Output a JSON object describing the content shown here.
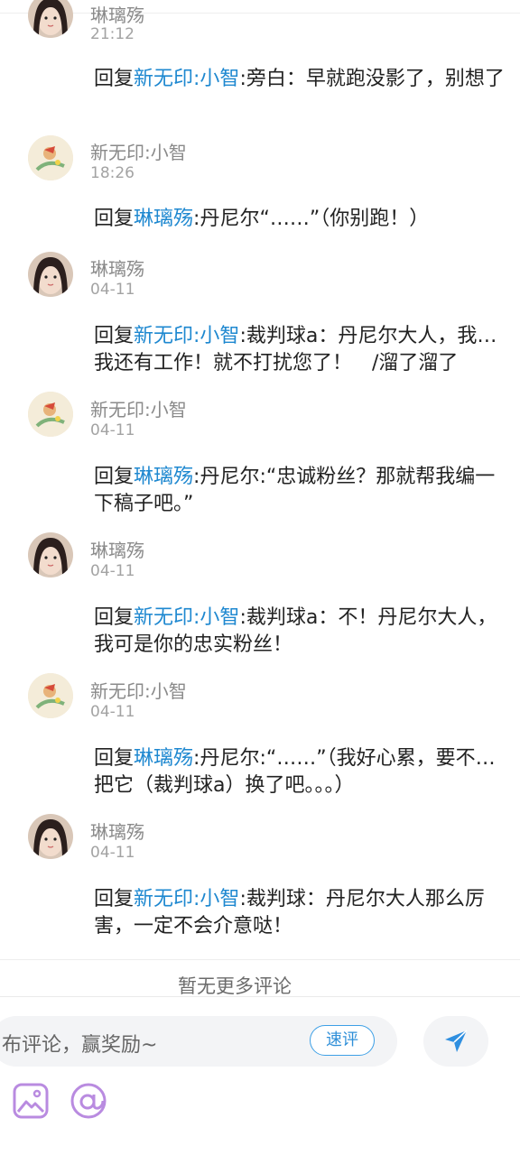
{
  "comments": [
    {
      "user": "琳璃殇",
      "time": "21:12",
      "lead": "回复",
      "mention": "新无印:小智",
      "text": ":旁白：早就跑没影了，别想了",
      "avatar": "girl"
    },
    {
      "user": "新无印:小智",
      "time": "18:26",
      "lead": "回复",
      "mention": "琳璃殇",
      "text": ":丹尼尔“……”（你别跑！）",
      "avatar": "boy"
    },
    {
      "user": "琳璃殇",
      "time": "04-11",
      "lead": "回复",
      "mention": "新无印:小智",
      "text": ":裁判球a：丹尼尔大人，我…我还有工作！就不打扰您了！　/溜了溜了",
      "avatar": "girl"
    },
    {
      "user": "新无印:小智",
      "time": "04-11",
      "lead": "回复",
      "mention": "琳璃殇",
      "text": ":丹尼尔:“忠诚粉丝？那就帮我编一下稿子吧。”",
      "avatar": "boy"
    },
    {
      "user": "琳璃殇",
      "time": "04-11",
      "lead": "回复",
      "mention": "新无印:小智",
      "text": ":裁判球a：不！丹尼尔大人，我可是你的忠实粉丝！",
      "avatar": "girl"
    },
    {
      "user": "新无印:小智",
      "time": "04-11",
      "lead": "回复",
      "mention": "琳璃殇",
      "text": ":丹尼尔:“……”（我好心累，要不…把它（裁判球a）换了吧。。。）",
      "avatar": "boy"
    },
    {
      "user": "琳璃殇",
      "time": "04-11",
      "lead": "回复",
      "mention": "新无印:小智",
      "text": ":裁判球：丹尼尔大人那么厉害，一定不会介意哒！",
      "avatar": "girl"
    }
  ],
  "footer": {
    "no_more": "暂无更多评论"
  },
  "bottom_bar": {
    "input_placeholder": "布评论，赢奖励~",
    "quick_comment_label": "速评",
    "send_icon": "send-plane-icon",
    "image_icon": "image-icon",
    "mention_icon": "at-sign-icon"
  },
  "colors": {
    "mention": "#1e88d0",
    "accent": "#3ea0e6",
    "icon_purple": "#b98be0"
  }
}
